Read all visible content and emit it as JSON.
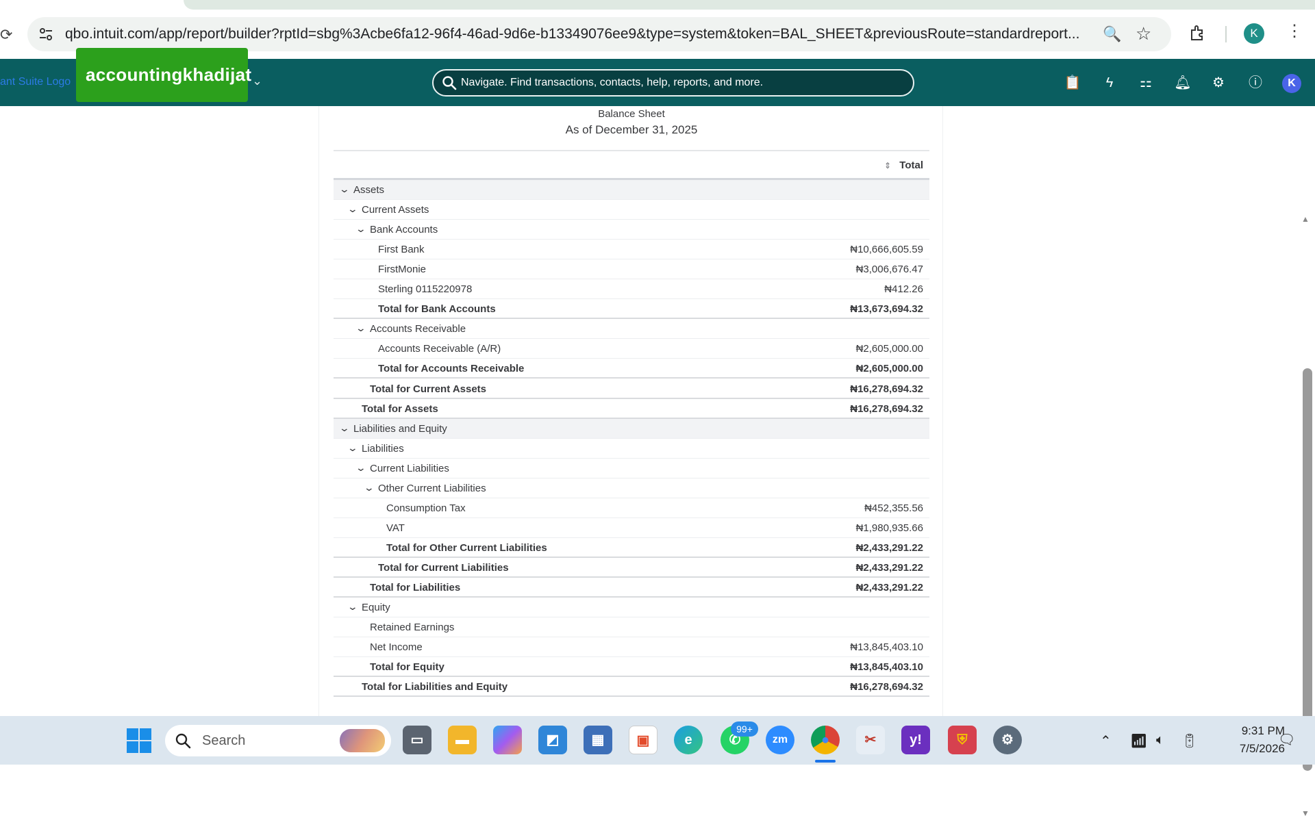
{
  "browser": {
    "url": "qbo.intuit.com/app/report/builder?rptId=sbg%3Acbe6fa12-96f4-46ad-9d6e-b13349076ee9&type=system&token=BAL_SHEET&previousRoute=standardreport...",
    "profile_initial": "K"
  },
  "header": {
    "logo_text": "ant Suite Logo",
    "company_name": "accountingkhadijat",
    "search_placeholder": "Navigate. Find transactions, contacts, help, reports, and more.",
    "avatar_initial": "K",
    "icons": [
      "clipboard-icon",
      "lightning-icon",
      "apps-icon",
      "bell-icon",
      "gear-icon",
      "help-icon"
    ]
  },
  "report": {
    "title": "Balance Sheet",
    "date": "As of December 31, 2025",
    "column_header": "Total",
    "rows": [
      {
        "label": "Assets",
        "amount": "",
        "kind": "section",
        "indent": 0,
        "chevron": true
      },
      {
        "label": "Current Assets",
        "amount": "",
        "kind": "group",
        "indent": 1,
        "chevron": true
      },
      {
        "label": "Bank Accounts",
        "amount": "",
        "kind": "group",
        "indent": 2,
        "chevron": true
      },
      {
        "label": "First Bank",
        "amount": "₦10,666,605.59",
        "kind": "line",
        "indent": 3,
        "chevron": false
      },
      {
        "label": "FirstMonie",
        "amount": "₦3,006,676.47",
        "kind": "line",
        "indent": 3,
        "chevron": false
      },
      {
        "label": "Sterling 0115220978",
        "amount": "₦412.26",
        "kind": "line",
        "indent": 3,
        "chevron": false
      },
      {
        "label": "Total for Bank Accounts",
        "amount": "₦13,673,694.32",
        "kind": "total",
        "indent": 3,
        "chevron": false
      },
      {
        "label": "Accounts Receivable",
        "amount": "",
        "kind": "group",
        "indent": 2,
        "chevron": true
      },
      {
        "label": "Accounts Receivable (A/R)",
        "amount": "₦2,605,000.00",
        "kind": "line",
        "indent": 3,
        "chevron": false
      },
      {
        "label": "Total for Accounts Receivable",
        "amount": "₦2,605,000.00",
        "kind": "total",
        "indent": 3,
        "chevron": false
      },
      {
        "label": "Total for Current Assets",
        "amount": "₦16,278,694.32",
        "kind": "total",
        "indent": 2,
        "chevron": false
      },
      {
        "label": "Total for Assets",
        "amount": "₦16,278,694.32",
        "kind": "total",
        "indent": 1,
        "chevron": false
      },
      {
        "label": "Liabilities and Equity",
        "amount": "",
        "kind": "section",
        "indent": 0,
        "chevron": true
      },
      {
        "label": "Liabilities",
        "amount": "",
        "kind": "group",
        "indent": 1,
        "chevron": true
      },
      {
        "label": "Current Liabilities",
        "amount": "",
        "kind": "group",
        "indent": 2,
        "chevron": true
      },
      {
        "label": "Other Current Liabilities",
        "amount": "",
        "kind": "group",
        "indent": 3,
        "chevron": true
      },
      {
        "label": "Consumption Tax",
        "amount": "₦452,355.56",
        "kind": "line",
        "indent": 4,
        "chevron": false
      },
      {
        "label": "VAT",
        "amount": "₦1,980,935.66",
        "kind": "line",
        "indent": 4,
        "chevron": false
      },
      {
        "label": "Total for Other Current Liabilities",
        "amount": "₦2,433,291.22",
        "kind": "total",
        "indent": 4,
        "chevron": false
      },
      {
        "label": "Total for Current Liabilities",
        "amount": "₦2,433,291.22",
        "kind": "total",
        "indent": 3,
        "chevron": false
      },
      {
        "label": "Total for Liabilities",
        "amount": "₦2,433,291.22",
        "kind": "total",
        "indent": 2,
        "chevron": false
      },
      {
        "label": "Equity",
        "amount": "",
        "kind": "group",
        "indent": 1,
        "chevron": true
      },
      {
        "label": "Retained Earnings",
        "amount": "",
        "kind": "line",
        "indent": 2,
        "chevron": false
      },
      {
        "label": "Net Income",
        "amount": "₦13,845,403.10",
        "kind": "line",
        "indent": 2,
        "chevron": false
      },
      {
        "label": "Total for Equity",
        "amount": "₦13,845,403.10",
        "kind": "total",
        "indent": 2,
        "chevron": false
      },
      {
        "label": "Total for Liabilities and Equity",
        "amount": "₦16,278,694.32",
        "kind": "total",
        "indent": 1,
        "chevron": false
      }
    ]
  },
  "taskbar": {
    "search_label": "Search",
    "whatsapp_badge": "99+",
    "time": "9:31 PM",
    "date": "7/5/2026",
    "apps": [
      "task-view-icon",
      "file-explorer-icon",
      "copilot-icon",
      "photos-icon",
      "calculator-icon",
      "store-icon",
      "edge-icon",
      "whatsapp-icon",
      "zoom-icon",
      "chrome-icon",
      "snipping-tool-icon",
      "yahoo-icon",
      "security-icon",
      "settings-icon"
    ]
  }
}
